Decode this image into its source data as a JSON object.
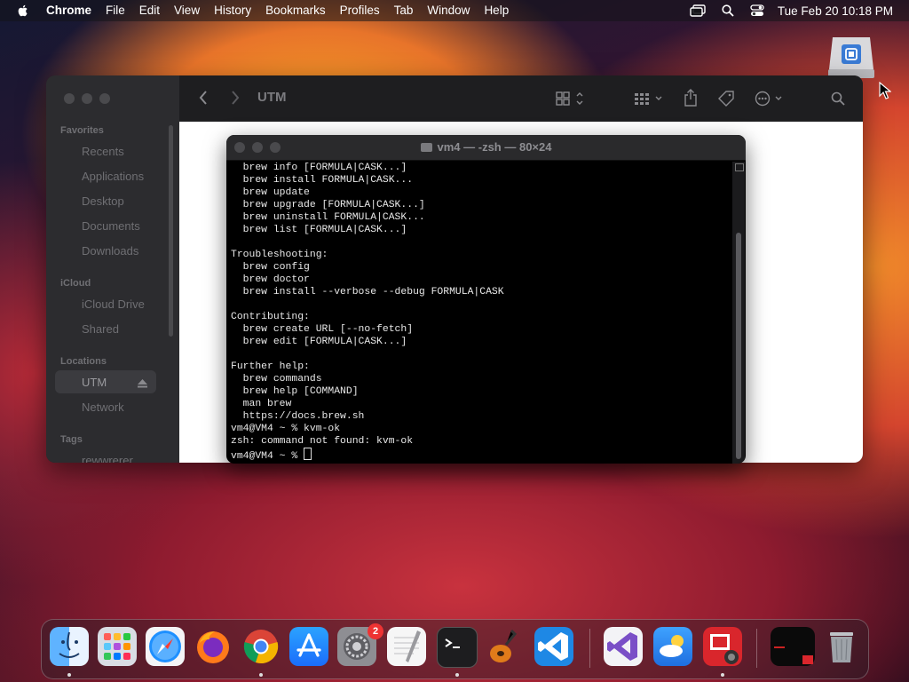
{
  "menubar": {
    "app_name": "Chrome",
    "items": [
      "File",
      "Edit",
      "View",
      "History",
      "Bookmarks",
      "Profiles",
      "Tab",
      "Window",
      "Help"
    ],
    "clock": "Tue Feb 20  10:18 PM"
  },
  "finder": {
    "title": "UTM",
    "sidebar": {
      "favorites_header": "Favorites",
      "favorites": [
        "Recents",
        "Applications",
        "Desktop",
        "Documents",
        "Downloads"
      ],
      "icloud_header": "iCloud",
      "icloud": [
        "iCloud Drive",
        "Shared"
      ],
      "locations_header": "Locations",
      "locations": [
        "UTM",
        "Network"
      ],
      "tags_header": "Tags",
      "tags": [
        "rewwrerer"
      ]
    }
  },
  "terminal": {
    "title": "vm4 — -zsh — 80×24",
    "lines": [
      "  brew info [FORMULA|CASK...]",
      "  brew install FORMULA|CASK...",
      "  brew update",
      "  brew upgrade [FORMULA|CASK...]",
      "  brew uninstall FORMULA|CASK...",
      "  brew list [FORMULA|CASK...]",
      "",
      "Troubleshooting:",
      "  brew config",
      "  brew doctor",
      "  brew install --verbose --debug FORMULA|CASK",
      "",
      "Contributing:",
      "  brew create URL [--no-fetch]",
      "  brew edit [FORMULA|CASK...]",
      "",
      "Further help:",
      "  brew commands",
      "  brew help [COMMAND]",
      "  man brew",
      "  https://docs.brew.sh",
      "vm4@VM4 ~ % kvm-ok",
      "zsh: command not found: kvm-ok"
    ],
    "prompt": "vm4@VM4 ~ % "
  },
  "dock": {
    "settings_badge": "2"
  }
}
